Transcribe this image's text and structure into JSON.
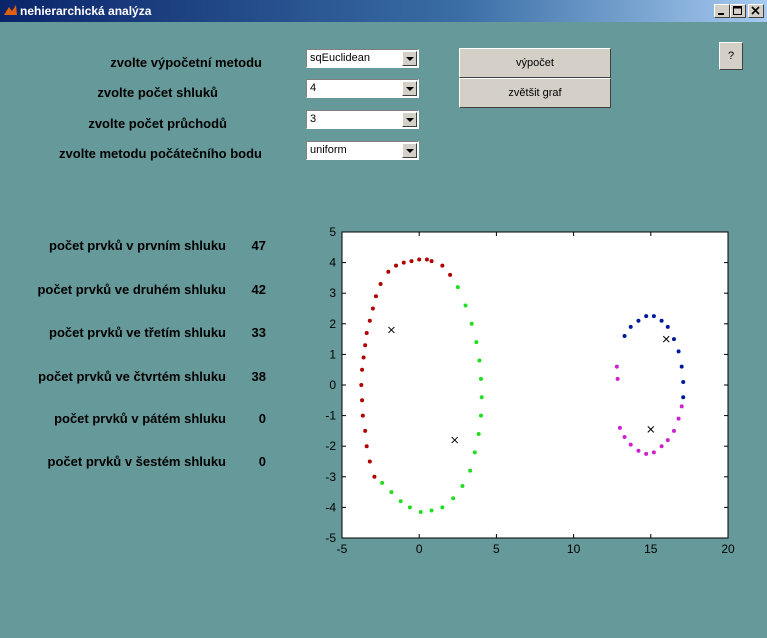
{
  "window": {
    "title": "nehierarchická analýza"
  },
  "help_label": "?",
  "params": [
    {
      "label": "zvolte výpočetní metodu",
      "value": "sqEuclidean"
    },
    {
      "label": "zvolte počet shluků",
      "value": "4"
    },
    {
      "label": "zvolte počet průchodů",
      "value": "3"
    },
    {
      "label": "zvolte metodu počátečního bodu",
      "value": "uniform"
    }
  ],
  "buttons": {
    "compute": "výpočet",
    "enlarge": "zvětšit graf"
  },
  "counts": [
    {
      "label": "počet prvků v prvním shluku",
      "value": "47"
    },
    {
      "label": "počet prvků ve druhém shluku",
      "value": "42"
    },
    {
      "label": "počet prvků ve třetím shluku",
      "value": "33"
    },
    {
      "label": "počet prvků ve čtvrtém shluku",
      "value": "38"
    },
    {
      "label": "počet prvků v pátém shluku",
      "value": "0"
    },
    {
      "label": "počet prvků v šestém shluku",
      "value": "0"
    }
  ],
  "chart_data": {
    "type": "scatter",
    "xlim": [
      -5,
      20
    ],
    "ylim": [
      -5,
      5
    ],
    "xticks": [
      "-5",
      "0",
      "5",
      "10",
      "15",
      "20"
    ],
    "yticks": [
      "-5",
      "-4",
      "-3",
      "-2",
      "-1",
      "0",
      "1",
      "2",
      "3",
      "4",
      "5"
    ],
    "grid": false,
    "clusters": [
      {
        "color": "#b00000",
        "points": [
          [
            -2.0,
            3.7
          ],
          [
            -1.5,
            3.9
          ],
          [
            -1.0,
            4.0
          ],
          [
            -0.5,
            4.05
          ],
          [
            0.0,
            4.1
          ],
          [
            0.5,
            4.1
          ],
          [
            0.8,
            4.05
          ],
          [
            -2.5,
            3.3
          ],
          [
            -2.8,
            2.9
          ],
          [
            -3.0,
            2.5
          ],
          [
            -3.2,
            2.1
          ],
          [
            -3.4,
            1.7
          ],
          [
            -3.5,
            1.3
          ],
          [
            -3.6,
            0.9
          ],
          [
            -3.7,
            0.5
          ],
          [
            -3.75,
            0.0
          ],
          [
            -3.7,
            -0.5
          ],
          [
            -3.65,
            -1.0
          ],
          [
            -3.5,
            -1.5
          ],
          [
            -3.4,
            -2.0
          ],
          [
            -3.2,
            -2.5
          ],
          [
            -2.9,
            -3.0
          ],
          [
            1.5,
            3.9
          ],
          [
            2.0,
            3.6
          ]
        ]
      },
      {
        "color": "#22dd22",
        "points": [
          [
            2.5,
            3.2
          ],
          [
            3.0,
            2.6
          ],
          [
            3.4,
            2.0
          ],
          [
            3.7,
            1.4
          ],
          [
            3.9,
            0.8
          ],
          [
            4.0,
            0.2
          ],
          [
            4.05,
            -0.4
          ],
          [
            4.0,
            -1.0
          ],
          [
            3.85,
            -1.6
          ],
          [
            3.6,
            -2.2
          ],
          [
            3.3,
            -2.8
          ],
          [
            2.8,
            -3.3
          ],
          [
            2.2,
            -3.7
          ],
          [
            1.5,
            -4.0
          ],
          [
            0.8,
            -4.1
          ],
          [
            0.1,
            -4.15
          ],
          [
            -0.6,
            -4.0
          ],
          [
            -1.2,
            -3.8
          ],
          [
            -1.8,
            -3.5
          ],
          [
            -2.4,
            -3.2
          ]
        ]
      },
      {
        "color": "#001a99",
        "points": [
          [
            13.3,
            1.6
          ],
          [
            13.7,
            1.9
          ],
          [
            14.2,
            2.1
          ],
          [
            14.7,
            2.25
          ],
          [
            15.2,
            2.25
          ],
          [
            15.7,
            2.1
          ],
          [
            16.1,
            1.9
          ],
          [
            16.5,
            1.5
          ],
          [
            16.8,
            1.1
          ],
          [
            17.0,
            0.6
          ],
          [
            17.1,
            0.1
          ],
          [
            17.1,
            -0.4
          ]
        ]
      },
      {
        "color": "#cc22cc",
        "points": [
          [
            12.8,
            0.6
          ],
          [
            12.85,
            0.2
          ],
          [
            13.0,
            -1.4
          ],
          [
            13.3,
            -1.7
          ],
          [
            13.7,
            -1.95
          ],
          [
            14.2,
            -2.15
          ],
          [
            14.7,
            -2.25
          ],
          [
            15.2,
            -2.2
          ],
          [
            15.7,
            -2.0
          ],
          [
            16.1,
            -1.8
          ],
          [
            16.5,
            -1.5
          ],
          [
            16.8,
            -1.1
          ],
          [
            17.0,
            -0.7
          ]
        ]
      }
    ],
    "centroids": [
      [
        -1.8,
        1.8
      ],
      [
        2.3,
        -1.8
      ],
      [
        16.0,
        1.5
      ],
      [
        15.0,
        -1.45
      ]
    ]
  }
}
